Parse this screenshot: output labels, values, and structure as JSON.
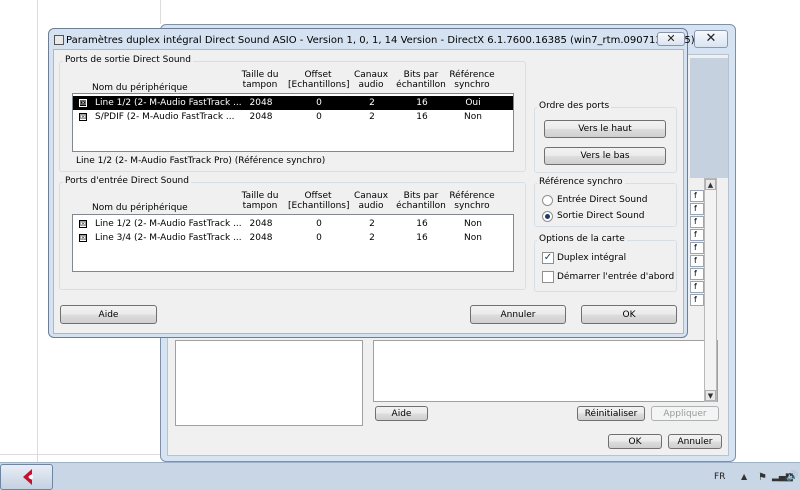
{
  "dialog": {
    "title": "Paramètres duplex intégral Direct Sound ASIO   -  Version 1, 0, 1, 14 Version   -  DirectX 6.1.7600.16385 (win7_rtm.090713-1255)",
    "close_glyph": "✕"
  },
  "output_ports": {
    "legend": "Ports de sortie Direct Sound",
    "headers": {
      "device": "Nom du périphérique",
      "buffer": "Taille du tampon",
      "offset": "Offset [Echantillons]",
      "channels": "Canaux audio",
      "bits": "Bits par échantillon",
      "sync": "Référence synchro"
    },
    "rows": [
      {
        "check": "☒",
        "device": "Line 1/2 (2- M-Audio FastTrack ...",
        "buffer": "2048",
        "offset": "0",
        "channels": "2",
        "bits": "16",
        "sync": "Oui"
      },
      {
        "check": "☒",
        "device": "S/PDIF (2- M-Audio FastTrack ...",
        "buffer": "2048",
        "offset": "0",
        "channels": "2",
        "bits": "16",
        "sync": "Non"
      }
    ],
    "status": "Line 1/2 (2- M-Audio FastTrack Pro) (Référence synchro)"
  },
  "input_ports": {
    "legend": "Ports d'entrée Direct Sound",
    "headers": {
      "device": "Nom du périphérique",
      "buffer": "Taille du tampon",
      "offset": "Offset [Echantillons]",
      "channels": "Canaux audio",
      "bits": "Bits par échantillon",
      "sync": "Référence synchro"
    },
    "rows": [
      {
        "check": "☒",
        "device": "Line 1/2 (2- M-Audio FastTrack ...",
        "buffer": "2048",
        "offset": "0",
        "channels": "2",
        "bits": "16",
        "sync": "Non"
      },
      {
        "check": "☒",
        "device": "Line 3/4 (2- M-Audio FastTrack ...",
        "buffer": "2048",
        "offset": "0",
        "channels": "2",
        "bits": "16",
        "sync": "Non"
      }
    ]
  },
  "port_order": {
    "legend": "Ordre des ports",
    "up_label": "Vers le haut",
    "down_label": "Vers le bas"
  },
  "sync_ref": {
    "legend": "Référence synchro",
    "option_input": "Entrée Direct Sound",
    "option_output": "Sortie Direct Sound",
    "selected": "Sortie Direct Sound"
  },
  "card_options": {
    "legend": "Options de la carte",
    "full_duplex_label": "Duplex intégral",
    "full_duplex_checked": true,
    "start_input_label": "Démarrer l'entrée d'abord",
    "start_input_checked": false
  },
  "buttons": {
    "help": "Aide",
    "cancel": "Annuler",
    "ok": "OK"
  },
  "background_window": {
    "close_glyph": "✕",
    "help": "Aide",
    "reset": "Réinitialiser",
    "apply": "Appliquer",
    "ok": "OK",
    "cancel": "Annuler",
    "cells": [
      "f",
      "f",
      "f",
      "f",
      "f",
      "f",
      "f",
      "f",
      "f"
    ],
    "scroll_up": "▲",
    "scroll_down": "▼"
  },
  "taskbar": {
    "language": "FR",
    "tray_arrow": "▲",
    "flag_icon": "⚑",
    "network_icon": "▂▄▆",
    "sound_icon": "🔊"
  },
  "colors": {
    "selection": "#000000",
    "dialog_frame": "#d5e2f2",
    "accent_logo": "#c8102e"
  }
}
